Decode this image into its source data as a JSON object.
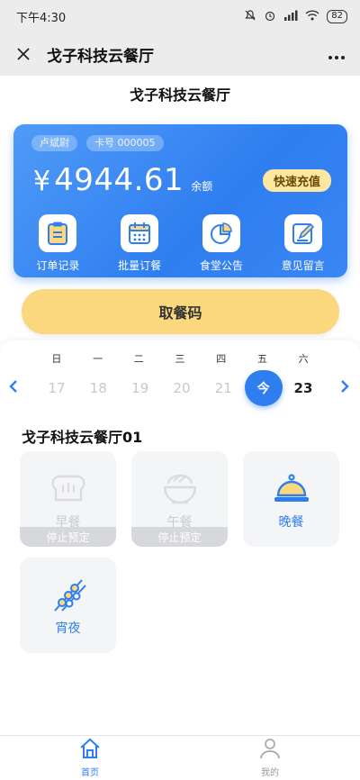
{
  "status_bar": {
    "time": "下午4:30",
    "battery": "82"
  },
  "nav": {
    "title": "戈子科技云餐厅"
  },
  "page": {
    "title": "戈子科技云餐厅"
  },
  "card": {
    "name_tag": "卢斌尉",
    "card_number": "卡号 000005",
    "currency": "¥",
    "balance": "4944.61",
    "balance_label": "余额",
    "recharge_label": "快速充值",
    "actions": [
      {
        "label": "订单记录",
        "icon": "clipboard-icon"
      },
      {
        "label": "批量订餐",
        "icon": "calendar-icon"
      },
      {
        "label": "食堂公告",
        "icon": "pie-chart-icon"
      },
      {
        "label": "意见留言",
        "icon": "edit-icon"
      }
    ]
  },
  "pickup_code_label": "取餐码",
  "calendar": {
    "weekdays": [
      "日",
      "一",
      "二",
      "三",
      "四",
      "五",
      "六"
    ],
    "dates": [
      "17",
      "18",
      "19",
      "20",
      "21",
      "今",
      "23"
    ]
  },
  "restaurant": {
    "name": "戈子科技云餐厅01",
    "meals": [
      {
        "label": "早餐",
        "status": "停止预定",
        "icon": "bread-icon"
      },
      {
        "label": "午餐",
        "status": "停止预定",
        "icon": "rice-bowl-icon"
      },
      {
        "label": "晚餐",
        "icon": "dish-cover-icon"
      },
      {
        "label": "宵夜",
        "icon": "skewer-icon"
      }
    ]
  },
  "tabs": [
    {
      "label": "首页",
      "icon": "home-icon"
    },
    {
      "label": "我的",
      "icon": "user-icon"
    }
  ],
  "colors": {
    "accent": "#2f7ef0",
    "pickup_bg": "#fbd77e",
    "recharge_bg": "#fde7a1"
  }
}
